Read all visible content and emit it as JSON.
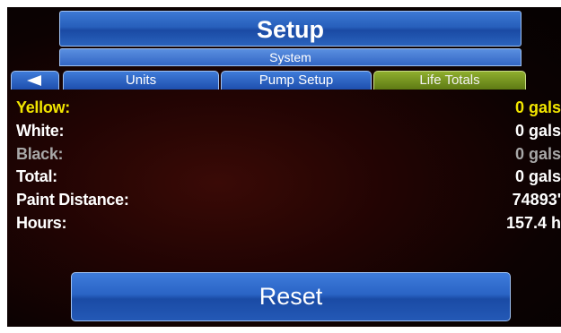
{
  "header": {
    "title": "Setup",
    "subtitle": "System"
  },
  "tabs": [
    {
      "label": "Units",
      "active": false
    },
    {
      "label": "Pump Setup",
      "active": false
    },
    {
      "label": "Life Totals",
      "active": true
    }
  ],
  "back_icon": "left-arrow-icon",
  "rows": [
    {
      "label": "Yellow:",
      "value": "0 gals",
      "color": "#f2e600"
    },
    {
      "label": "White:",
      "value": "0 gals",
      "color": "#ffffff"
    },
    {
      "label": "Black:",
      "value": "0 gals",
      "color": "#a8a8a8"
    },
    {
      "label": "Total:",
      "value": "0 gals",
      "color": "#ffffff"
    },
    {
      "label": "Paint Distance:",
      "value": "74893'",
      "color": "#ffffff"
    },
    {
      "label": "Hours:",
      "value": "157.4 h",
      "color": "#ffffff"
    }
  ],
  "reset_label": "Reset",
  "colors": {
    "accent_blue": "#2a63bd",
    "active_tab": "#7a9620",
    "background": "#1a0302"
  }
}
